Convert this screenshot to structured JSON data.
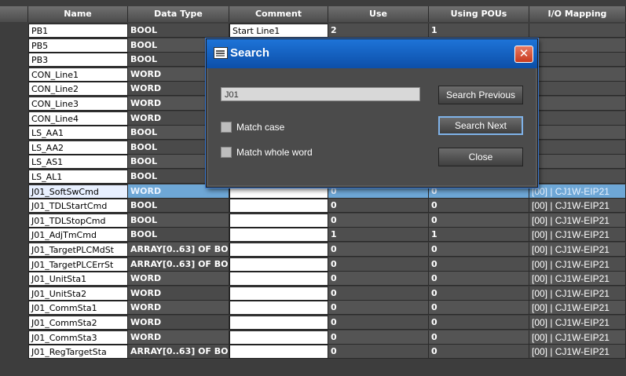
{
  "columns": [
    "Name",
    "Data Type",
    "Comment",
    "Use",
    "Using POUs",
    "I/O Mapping"
  ],
  "rows": [
    {
      "name": "PB1",
      "type": "BOOL",
      "comment": "Start Line1",
      "use": "2",
      "pous": "1",
      "io": ""
    },
    {
      "name": "PB5",
      "type": "BOOL",
      "comment": "",
      "use": "",
      "pous": "",
      "io": ""
    },
    {
      "name": "PB3",
      "type": "BOOL",
      "comment": "",
      "use": "",
      "pous": "",
      "io": ""
    },
    {
      "name": "CON_Line1",
      "type": "WORD",
      "comment": "",
      "use": "",
      "pous": "",
      "io": ""
    },
    {
      "name": "CON_Line2",
      "type": "WORD",
      "comment": "",
      "use": "",
      "pous": "",
      "io": ""
    },
    {
      "name": "CON_Line3",
      "type": "WORD",
      "comment": "",
      "use": "",
      "pous": "",
      "io": ""
    },
    {
      "name": "CON_Line4",
      "type": "WORD",
      "comment": "",
      "use": "",
      "pous": "",
      "io": ""
    },
    {
      "name": "LS_AA1",
      "type": "BOOL",
      "comment": "",
      "use": "",
      "pous": "",
      "io": ""
    },
    {
      "name": "LS_AA2",
      "type": "BOOL",
      "comment": "",
      "use": "",
      "pous": "",
      "io": ""
    },
    {
      "name": "LS_AS1",
      "type": "BOOL",
      "comment": "",
      "use": "",
      "pous": "",
      "io": ""
    },
    {
      "name": "LS_AL1",
      "type": "BOOL",
      "comment": "",
      "use": "",
      "pous": "",
      "io": ""
    },
    {
      "name": "J01_SoftSwCmd",
      "type": "WORD",
      "comment": "",
      "use": "0",
      "pous": "0",
      "io": "[00] | CJ1W-EIP21",
      "selected": true
    },
    {
      "name": "J01_TDLStartCmd",
      "type": "BOOL",
      "comment": "",
      "use": "0",
      "pous": "0",
      "io": "[00] | CJ1W-EIP21"
    },
    {
      "name": "J01_TDLStopCmd",
      "type": "BOOL",
      "comment": "",
      "use": "0",
      "pous": "0",
      "io": "[00] | CJ1W-EIP21"
    },
    {
      "name": "J01_AdjTmCmd",
      "type": "BOOL",
      "comment": "",
      "use": "1",
      "pous": "1",
      "io": "[00] | CJ1W-EIP21"
    },
    {
      "name": "J01_TargetPLCMdSt",
      "type": "ARRAY[0..63] OF BO",
      "comment": "",
      "use": "0",
      "pous": "0",
      "io": "[00] | CJ1W-EIP21"
    },
    {
      "name": "J01_TargetPLCErrSt",
      "type": "ARRAY[0..63] OF BO",
      "comment": "",
      "use": "0",
      "pous": "0",
      "io": "[00] | CJ1W-EIP21"
    },
    {
      "name": "J01_UnitSta1",
      "type": "WORD",
      "comment": "",
      "use": "0",
      "pous": "0",
      "io": "[00] | CJ1W-EIP21"
    },
    {
      "name": "J01_UnitSta2",
      "type": "WORD",
      "comment": "",
      "use": "0",
      "pous": "0",
      "io": "[00] | CJ1W-EIP21"
    },
    {
      "name": "J01_CommSta1",
      "type": "WORD",
      "comment": "",
      "use": "0",
      "pous": "0",
      "io": "[00] | CJ1W-EIP21"
    },
    {
      "name": "J01_CommSta2",
      "type": "WORD",
      "comment": "",
      "use": "0",
      "pous": "0",
      "io": "[00] | CJ1W-EIP21"
    },
    {
      "name": "J01_CommSta3",
      "type": "WORD",
      "comment": "",
      "use": "0",
      "pous": "0",
      "io": "[00] | CJ1W-EIP21"
    },
    {
      "name": "J01_RegTargetSta",
      "type": "ARRAY[0..63] OF BO",
      "comment": "",
      "use": "0",
      "pous": "0",
      "io": "[00] | CJ1W-EIP21"
    }
  ],
  "dialog": {
    "title": "Search",
    "close_glyph": "✕",
    "search_value": "J01",
    "match_case": "Match case",
    "match_case_checked": false,
    "match_whole_word": "Match whole word",
    "match_whole_word_checked": false,
    "btn_prev": "Search Previous",
    "btn_next": "Search Next",
    "btn_close": "Close"
  }
}
